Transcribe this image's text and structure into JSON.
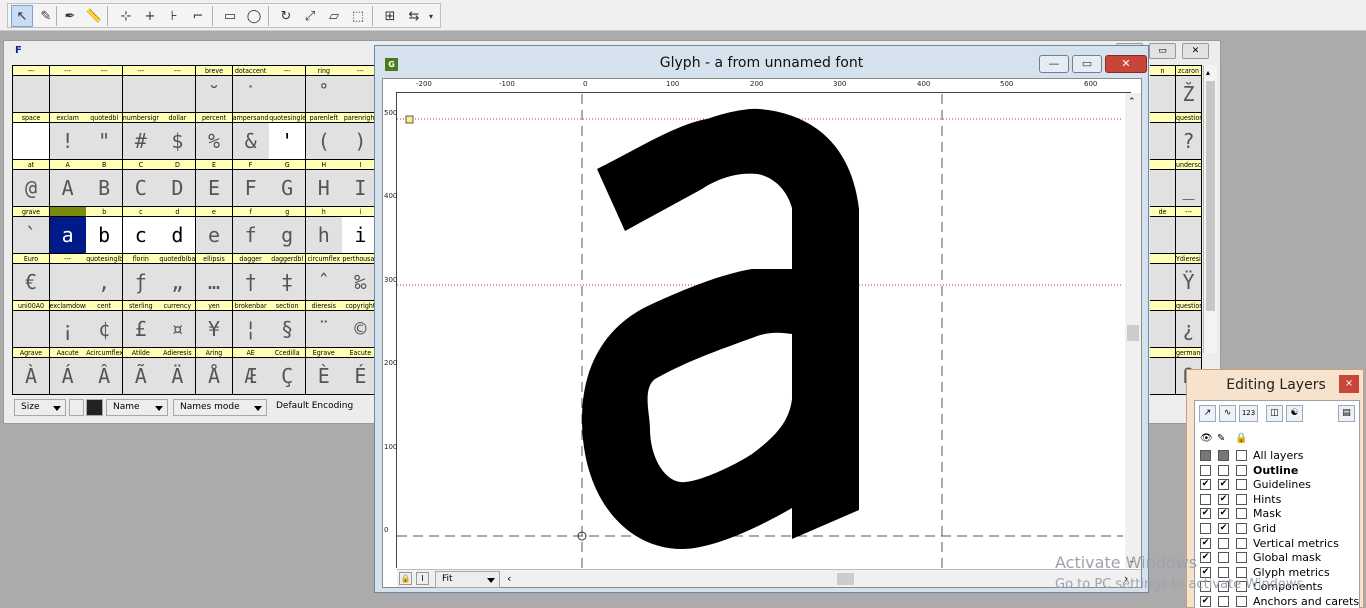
{
  "toolbar": {
    "icons": [
      "pointer-icon",
      "pencil-icon",
      "pen-icon",
      "ruler-icon",
      "add-curve-point-icon",
      "add-corner-point-icon",
      "add-tangent-point-icon",
      "add-hv-curve-icon",
      "rectangle-icon",
      "ellipse-icon",
      "rotate-icon",
      "scale-icon",
      "skew-icon",
      "flip-icon",
      "spiro-icon",
      "align-icon",
      "dropdown-arrow-icon"
    ]
  },
  "fontview": {
    "grid_rows": [
      {
        "labels": [
          "---",
          "---",
          "---",
          "---",
          "---",
          "breve",
          "dotaccent",
          "---",
          "ring",
          "---"
        ],
        "glyphs": [
          "",
          "",
          "",
          "",
          "",
          "˘",
          "˙",
          "",
          "˚",
          ""
        ]
      },
      {
        "labels": [
          "space",
          "exclam",
          "quotedbl",
          "numbersign",
          "dollar",
          "percent",
          "ampersand",
          "quotesingle",
          "parenleft",
          "parenright"
        ],
        "glyphs": [
          "",
          "!",
          "\"",
          "#",
          "$",
          "%",
          "&",
          "'",
          "(",
          ")"
        ]
      },
      {
        "labels": [
          "at",
          "A",
          "B",
          "C",
          "D",
          "E",
          "F",
          "G",
          "H",
          "I"
        ],
        "glyphs": [
          "@",
          "A",
          "B",
          "C",
          "D",
          "E",
          "F",
          "G",
          "H",
          "I"
        ]
      },
      {
        "labels": [
          "grave",
          "a",
          "b",
          "c",
          "d",
          "e",
          "f",
          "g",
          "h",
          "i"
        ],
        "glyphs": [
          "`",
          "a",
          "b",
          "c",
          "d",
          "e",
          "f",
          "g",
          "h",
          "i"
        ]
      },
      {
        "labels": [
          "Euro",
          "---",
          "quotesinglbase",
          "florin",
          "quotedblbase",
          "ellipsis",
          "dagger",
          "daggerdbl",
          "circumflex",
          "perthousand"
        ],
        "glyphs": [
          "€",
          "",
          "‚",
          "ƒ",
          "„",
          "…",
          "†",
          "‡",
          "ˆ",
          "‰"
        ]
      },
      {
        "labels": [
          "uni00A0",
          "exclamdown",
          "cent",
          "sterling",
          "currency",
          "yen",
          "brokenbar",
          "section",
          "dieresis",
          "copyright"
        ],
        "glyphs": [
          "",
          "¡",
          "¢",
          "£",
          "¤",
          "¥",
          "¦",
          "§",
          "¨",
          "©"
        ]
      },
      {
        "labels": [
          "Agrave",
          "Aacute",
          "Acircumflex",
          "Atilde",
          "Adieresis",
          "Aring",
          "AE",
          "Ccedilla",
          "Egrave",
          "Eacute"
        ],
        "glyphs": [
          "À",
          "Á",
          "Â",
          "Ã",
          "Ä",
          "Å",
          "Æ",
          "Ç",
          "È",
          "É"
        ]
      }
    ],
    "right_rows": [
      {
        "labels": [
          "n",
          "zcaron"
        ],
        "glyphs": [
          "",
          "Ž"
        ]
      },
      {
        "labels": [
          "",
          "question"
        ],
        "glyphs": [
          "",
          "?"
        ]
      },
      {
        "labels": [
          "",
          "underscore"
        ],
        "glyphs": [
          "",
          "_"
        ]
      },
      {
        "labels": [
          "de",
          "---"
        ],
        "glyphs": [
          "",
          ""
        ]
      },
      {
        "labels": [
          "",
          "Ydieresis"
        ],
        "glyphs": [
          "",
          "Ÿ"
        ]
      },
      {
        "labels": [
          "",
          "questiondown"
        ],
        "glyphs": [
          "",
          "¿"
        ]
      },
      {
        "labels": [
          "",
          "germandbls"
        ],
        "glyphs": [
          "",
          "ß"
        ]
      }
    ],
    "bottom": {
      "size_label": "Size",
      "name_label": "Name",
      "names_mode_label": "Names mode",
      "encoding_label": "Default Encoding"
    },
    "ctrl_symbols": [
      "—",
      "▭",
      "✕"
    ]
  },
  "glyphwin": {
    "title": "Glyph - a from unnamed font",
    "icon_letter": "G",
    "buttons": {
      "minimize": "—",
      "maximize": "▭",
      "close": "✕"
    },
    "hruler_ticks": [
      "-200",
      "-100",
      "0",
      "100",
      "200",
      "300",
      "400",
      "500",
      "600"
    ],
    "vruler_ticks": [
      "500",
      "400",
      "300",
      "200",
      "100",
      "0"
    ],
    "zoom_label": "Fit",
    "lock_symbol": "🔒",
    "info_symbol": "I"
  },
  "layers_panel": {
    "title": "Editing Layers",
    "close_symbol": "×",
    "rows": [
      {
        "label": "All layers",
        "bold": false,
        "c1": "filled",
        "c2": "filled",
        "c3": ""
      },
      {
        "label": "Outline",
        "bold": true,
        "c1": "",
        "c2": "",
        "c3": ""
      },
      {
        "label": "Guidelines",
        "bold": false,
        "c1": "✔",
        "c2": "✔",
        "c3": ""
      },
      {
        "label": "Hints",
        "bold": false,
        "c1": "",
        "c2": "✔",
        "c3": ""
      },
      {
        "label": "Mask",
        "bold": false,
        "c1": "✔",
        "c2": "✔",
        "c3": ""
      },
      {
        "label": "Grid",
        "bold": false,
        "c1": "",
        "c2": "✔",
        "c3": ""
      },
      {
        "label": "Vertical metrics",
        "bold": false,
        "c1": "✔",
        "c2": "",
        "c3": ""
      },
      {
        "label": "Global mask",
        "bold": false,
        "c1": "✔",
        "c2": "",
        "c3": ""
      },
      {
        "label": "Glyph metrics",
        "bold": false,
        "c1": "✔",
        "c2": "",
        "c3": ""
      },
      {
        "label": "Components",
        "bold": false,
        "c1": "",
        "c2": "",
        "c3": ""
      },
      {
        "label": "Anchors and carets",
        "bold": false,
        "c1": "✔",
        "c2": "",
        "c3": ""
      }
    ],
    "header_icons": [
      "eye-icon",
      "edit-icon",
      "lock-icon"
    ]
  },
  "watermark": {
    "line1": "Activate Windows",
    "line2": "Go to PC settings to activate Windows."
  }
}
